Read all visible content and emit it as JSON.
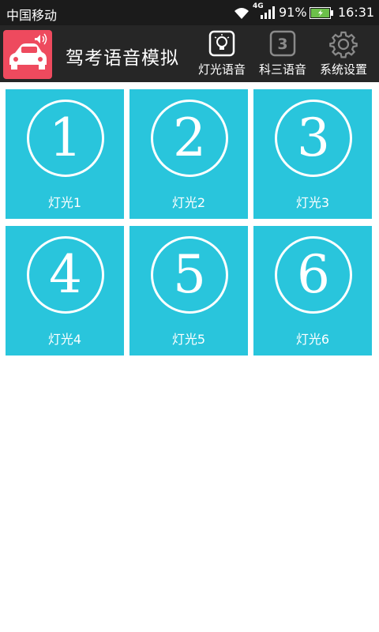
{
  "status_bar": {
    "carrier": "中国移动",
    "network_type": "4G",
    "battery_percent": "91%",
    "time": "16:31",
    "icons": [
      "wifi-icon",
      "signal-icon",
      "battery-charging-icon"
    ]
  },
  "app_bar": {
    "title": "驾考语音模拟",
    "app_icon": "car-speaker-icon",
    "actions": [
      {
        "label": "灯光语音",
        "icon": "light-bulb-icon"
      },
      {
        "label": "科三语音",
        "icon": "number-three-icon",
        "icon_text": "3"
      },
      {
        "label": "系统设置",
        "icon": "gear-icon"
      }
    ]
  },
  "grid": {
    "tiles": [
      {
        "number": "1",
        "label": "灯光1"
      },
      {
        "number": "2",
        "label": "灯光2"
      },
      {
        "number": "3",
        "label": "灯光3"
      },
      {
        "number": "4",
        "label": "灯光4"
      },
      {
        "number": "5",
        "label": "灯光5"
      },
      {
        "number": "6",
        "label": "灯光6"
      }
    ]
  },
  "colors": {
    "status_bar_bg": "#1b1b1b",
    "app_bar_bg": "#262626",
    "app_icon_bg": "#ee4a5e",
    "tile_bg": "#29c5dc",
    "page_bg": "#ffffff"
  }
}
